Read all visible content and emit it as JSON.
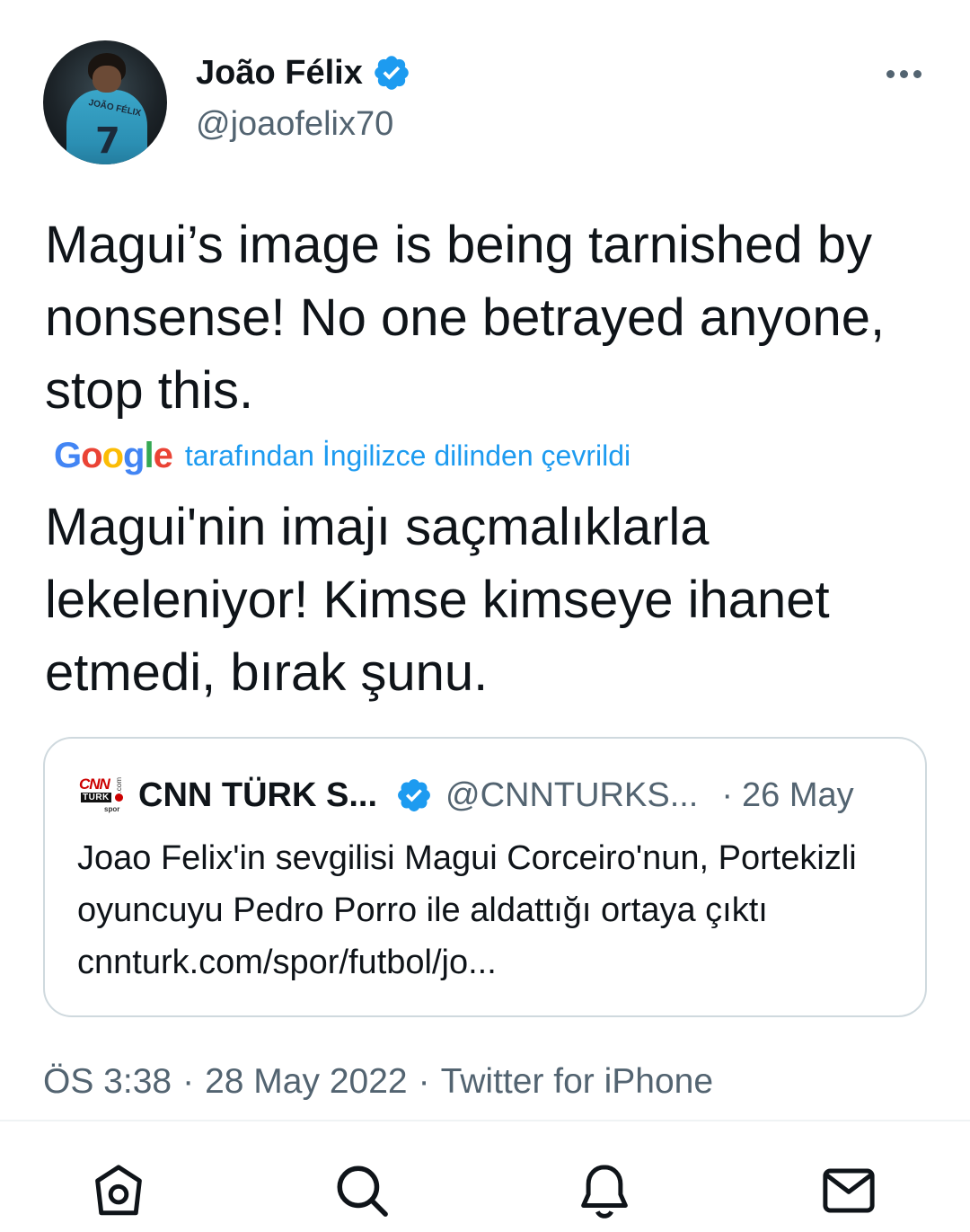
{
  "tweet": {
    "author": {
      "display_name": "João Félix",
      "handle": "@joaofelix70",
      "avatar_jersey_name": "JOÃO FÉLIX",
      "avatar_jersey_number": "7",
      "verified": true
    },
    "text": "Magui’s image is being tarnished by nonsense! No one betrayed anyone, stop this.",
    "translation": {
      "provider": "Google",
      "label": "tarafından İngilizce dilinden çevrildi",
      "text": "Magui'nin imajı saçmalıklarla lekeleniyor! Kimse kimseye ihanet etmedi, bırak şunu."
    },
    "quoted_tweet": {
      "logo": {
        "main": "CNN",
        "sub": "TÜRK",
        "side": ".com",
        "section": "spor"
      },
      "display_name": "CNN TÜRK S...",
      "handle": "@CNNTURKS...",
      "separator": "·",
      "date": "26 May",
      "text": "Joao Felix'in sevgilisi Magui Corceiro'nun, Portekizli oyuncuyu Pedro Porro ile aldattığı ortaya çıktı cnnturk.com/spor/futbol/jo..."
    },
    "meta": {
      "time": "ÖS 3:38",
      "date": "28 May 2022",
      "source": "Twitter for iPhone",
      "separator": "·"
    }
  },
  "icons": {
    "more": "more-options-icon",
    "verified": "verified-badge-icon",
    "nav": [
      "home-icon",
      "search-icon",
      "notifications-icon",
      "messages-icon"
    ]
  },
  "colors": {
    "accent": "#1d9bf0",
    "text_primary": "#0f1419",
    "text_secondary": "#536471",
    "border": "#cfd9de"
  }
}
